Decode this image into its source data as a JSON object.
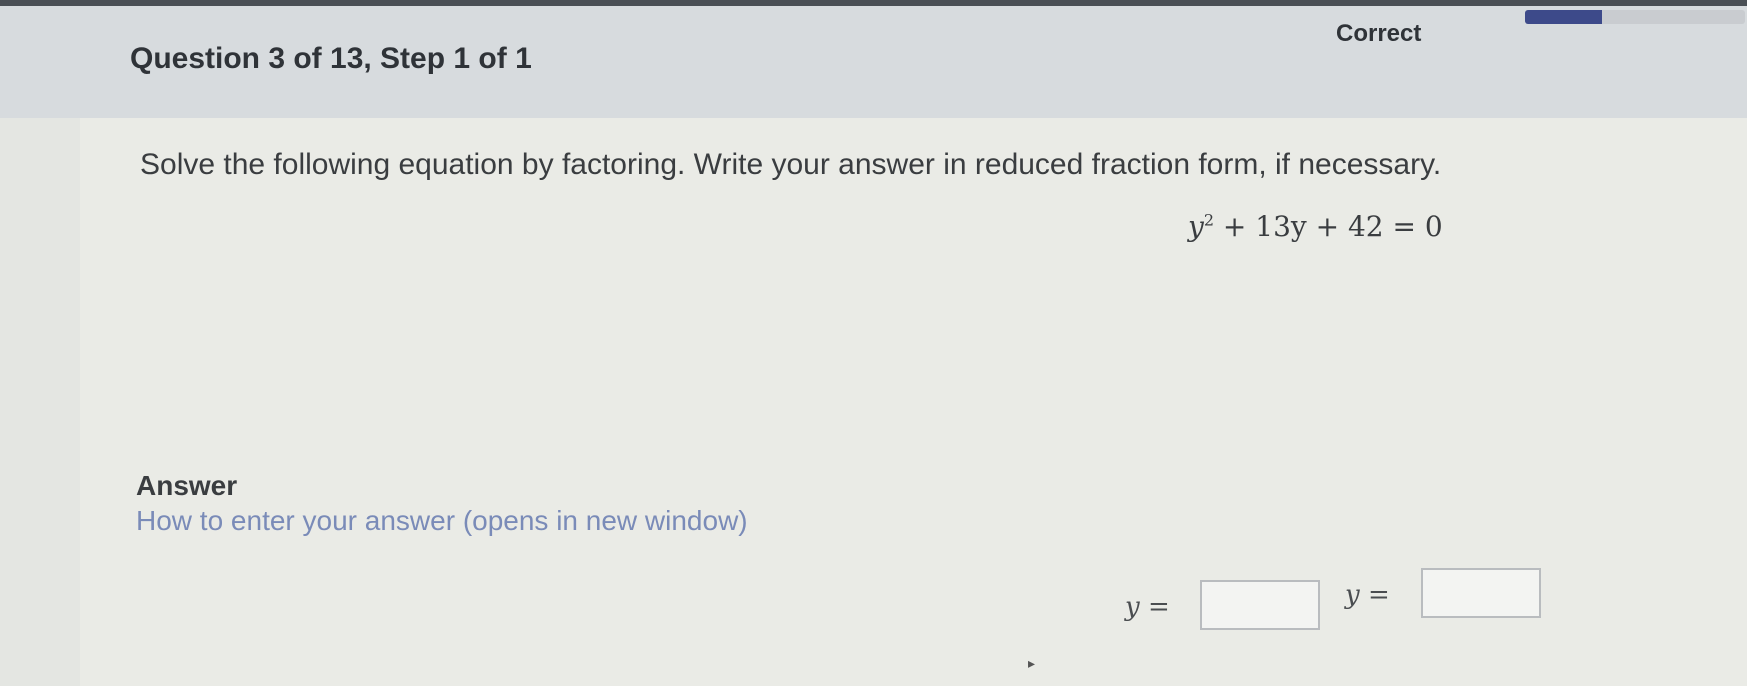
{
  "header": {
    "question_title": "Question 3 of 13, Step 1 of 1",
    "status_label": "Correct",
    "progress_fraction": 0.35
  },
  "problem": {
    "instruction": "Solve the following equation by factoring. Write your answer in reduced fraction form, if necessary.",
    "equation_base": "y",
    "equation_exponent": "2",
    "equation_rest": " + 13y + 42 = 0"
  },
  "answer": {
    "heading": "Answer",
    "help_link": "How to enter your answer (opens in new window)",
    "fields": [
      {
        "label": "y =",
        "value": ""
      },
      {
        "label": "y =",
        "value": ""
      }
    ]
  },
  "colors": {
    "accent": "#3d4a8a",
    "link": "#7a8bb8"
  }
}
